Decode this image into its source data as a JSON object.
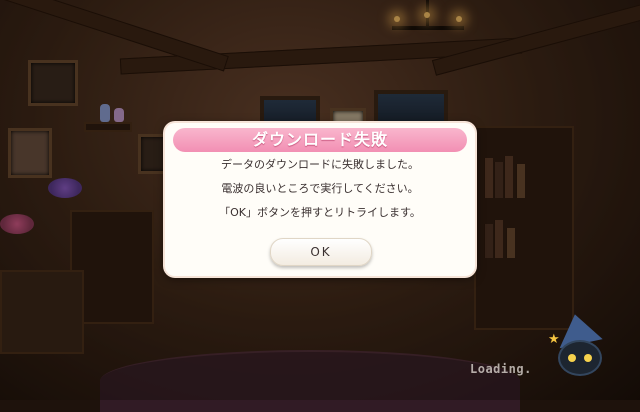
{
  "dialog": {
    "title": "ダウンロード失敗",
    "lines": [
      "データのダウンロードに失敗しました。",
      "電波の良いところで実行してください。",
      "「OK」ボタンを押すとリトライします。"
    ],
    "ok_label": "OK"
  },
  "status": {
    "loading_text": "Loading."
  },
  "colors": {
    "header_pink": "#f28fb3",
    "dialog_bg": "#fffdf8",
    "text": "#3a3030"
  }
}
